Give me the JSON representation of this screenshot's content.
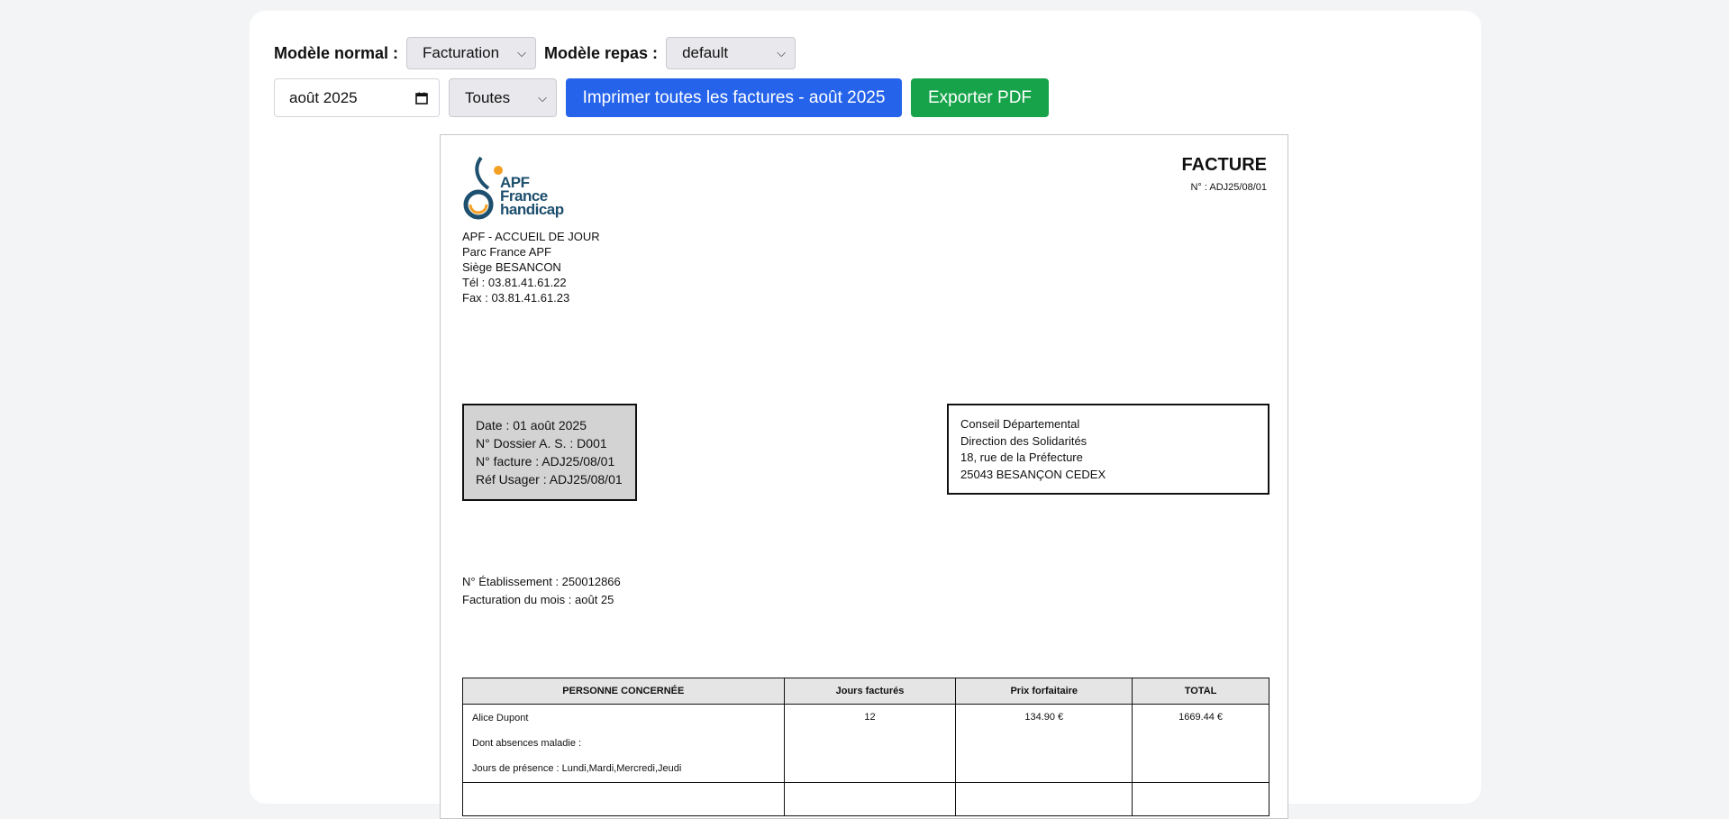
{
  "controls": {
    "normal_label": "Modèle normal :",
    "normal_value": "Facturation",
    "repas_label": "Modèle repas :",
    "repas_value": "default",
    "month_value": "août  2025",
    "filter_value": "Toutes",
    "print_button": "Imprimer toutes les factures - août 2025",
    "export_button": "Exporter PDF",
    "icons": {
      "dropdown": "chevron-down-icon",
      "calendar": "calendar-icon"
    }
  },
  "invoice": {
    "logo": {
      "line1": "APF",
      "line2": "France",
      "line3": "handicap"
    },
    "sender": [
      "APF - ACCUEIL DE JOUR",
      "Parc France APF",
      "Siège BESANCON",
      "Tél : 03.81.41.61.22",
      "Fax : 03.81.41.61.23"
    ],
    "title": "FACTURE",
    "number_ref": "N° : ADJ25/08/01",
    "info": [
      "Date : 01 août 2025",
      "N° Dossier A. S. : D001",
      "N° facture : ADJ25/08/01",
      "Réf Usager : ADJ25/08/01"
    ],
    "recipient": [
      "Conseil Départemental",
      "Direction des Solidarités",
      "18, rue de la Préfecture",
      "25043 BESANÇON CEDEX"
    ],
    "etablissement": "N° Établissement : 250012866",
    "facturation_mois": "Facturation du mois : août 25",
    "table": {
      "headers": [
        "PERSONNE CONCERNÉE",
        "Jours facturés",
        "Prix forfaitaire",
        "TOTAL"
      ],
      "row": {
        "name": "Alice Dupont",
        "absences": "Dont absences maladie :",
        "presence": "Jours de présence : Lundi,Mardi,Mercredi,Jeudi",
        "jours": "12",
        "prix": "134.90 €",
        "total": "1669.44 €"
      }
    }
  },
  "colors": {
    "primary": "#2563eb",
    "success": "#16a34a",
    "logo_blue": "#1d4f6e",
    "logo_orange": "#f4a024"
  }
}
